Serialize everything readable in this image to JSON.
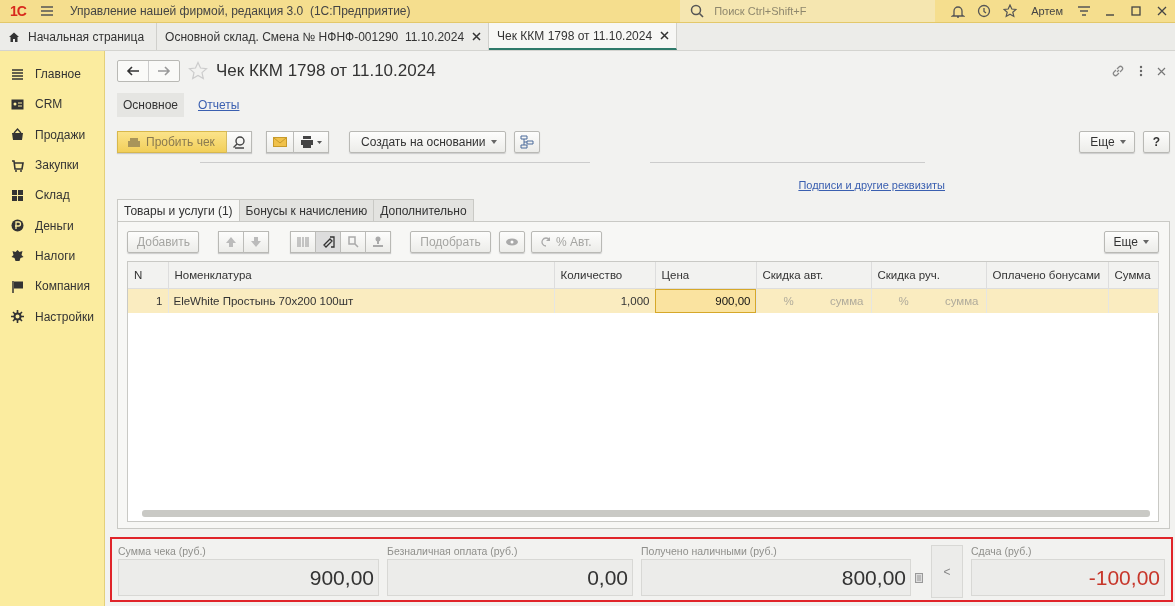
{
  "title_bar": {
    "logo": "1С",
    "app_title": "Управление нашей фирмой, редакция 3.0  (1С:Предприятие)",
    "search_placeholder": "Поиск Ctrl+Shift+F",
    "user": "Артем"
  },
  "open_tabs": [
    {
      "kind": "home",
      "label": "Начальная страница",
      "selected": false
    },
    {
      "kind": "doc",
      "label": "Основной склад. Смена № НФНФ-001290  11.10.2024",
      "selected": false
    },
    {
      "kind": "doc",
      "label": "Чек ККМ 1798 от 11.10.2024",
      "selected": true
    }
  ],
  "sidebar": {
    "items": [
      {
        "label": "Главное"
      },
      {
        "label": "CRM"
      },
      {
        "label": "Продажи"
      },
      {
        "label": "Закупки"
      },
      {
        "label": "Склад"
      },
      {
        "label": "Деньги"
      },
      {
        "label": "Налоги"
      },
      {
        "label": "Компания"
      },
      {
        "label": "Настройки"
      }
    ]
  },
  "form": {
    "title": "Чек ККМ 1798 от 11.10.2024",
    "sections": [
      {
        "label": "Основное",
        "selected": true
      },
      {
        "label": "Отчеты",
        "selected": false
      }
    ],
    "toolbar": {
      "print_receipt": "Пробить чек",
      "create_based_on": "Создать на основании",
      "more": "Еще",
      "help": "?"
    },
    "details_link": "Подписи и другие реквизиты",
    "tabs": [
      {
        "label": "Товары и услуги (1)",
        "selected": true
      },
      {
        "label": "Бонусы к начислению",
        "selected": false
      },
      {
        "label": "Дополнительно",
        "selected": false
      }
    ],
    "table_toolbar": {
      "add": {
        "label": "Добавить",
        "disabled": true
      },
      "pick": {
        "label": "Подобрать",
        "disabled": true
      },
      "auto_discount": {
        "label": "% Авт.",
        "disabled": true
      },
      "more": {
        "label": "Еще",
        "disabled": false
      }
    },
    "table": {
      "columns": [
        "N",
        "Номенклатура",
        "Количество",
        "Цена",
        "Скидка авт.",
        "Скидка руч.",
        "Оплачено бонусами",
        "Сумма"
      ],
      "rows": [
        {
          "selected": true,
          "cells": [
            {
              "text": "1",
              "selected": false
            },
            {
              "text": "EleWhite Простынь 70х200 100шт",
              "selected": false
            },
            {
              "text": "1,000",
              "selected": false
            },
            {
              "text": "900,00",
              "selected": true
            },
            {
              "parts": [
                "%",
                "сумма"
              ],
              "selected": false
            },
            {
              "parts": [
                "%",
                "сумма"
              ],
              "selected": false
            },
            {
              "selected": false
            },
            {
              "selected": false
            }
          ]
        }
      ]
    }
  },
  "totals": {
    "highlighted": true,
    "items": [
      {
        "kind": "field",
        "label": "Сумма чека (руб.)",
        "value": "900,00",
        "negative": false
      },
      {
        "kind": "field",
        "label": "Безналичная оплата (руб.)",
        "value": "0,00",
        "negative": false
      },
      {
        "kind": "cash",
        "label": "Получено наличными (руб.)",
        "value": "800,00",
        "negative": false
      },
      {
        "kind": "button",
        "text": "<"
      },
      {
        "kind": "field",
        "label": "Сдача (руб.)",
        "value": "-100,00",
        "negative": true
      }
    ]
  }
}
